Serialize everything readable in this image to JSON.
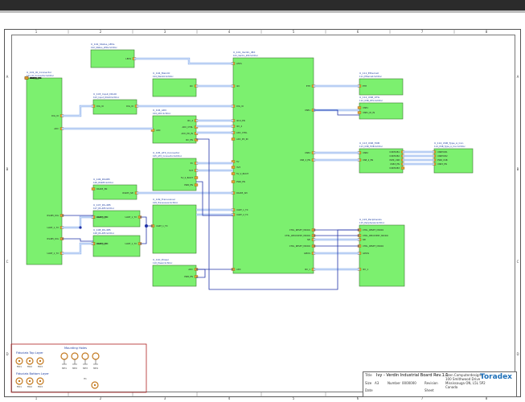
{
  "sheet": {
    "grid_cols": [
      "1",
      "2",
      "3",
      "4",
      "5",
      "6",
      "7",
      "8"
    ],
    "grid_rows": [
      "A",
      "B",
      "C",
      "D"
    ]
  },
  "blocks": [
    {
      "id": "custom",
      "title": "U_101_IO_Connector",
      "subtitle": "101_IO_Connector.SchDoc",
      "pins_left": [
        "DIG_IO",
        "ADC",
        "RS485_DIG",
        "UART_1_TX",
        "RS485_DIG",
        "UART_1_TX"
      ],
      "pins_right": []
    },
    {
      "id": "leds",
      "title": "U_102_Status_LEDs",
      "subtitle": "102_Status_LEDs.SchDoc",
      "pins_right": [
        "LEDS"
      ]
    },
    {
      "id": "main",
      "title": "U_101_Verdin_iMX",
      "subtitle": "101_Verdin_iMX.SchDoc"
    },
    {
      "id": "mux",
      "title": "U_104_MainIO",
      "subtitle": "104_MainIO.SchDoc",
      "pins_right": [
        "I2C"
      ]
    },
    {
      "id": "dig",
      "title": "U_103_Input_DIGIO",
      "subtitle": "103_Input_DIGIO.SchDoc",
      "pins_left": [
        "DIG_IO"
      ],
      "pins_right": [
        "DIG_IO"
      ]
    },
    {
      "id": "adc",
      "title": "U_104_ADC",
      "subtitle": "104_ADC.SchDoc",
      "pins_left": [
        "ADC"
      ],
      "pins_right": [
        "I2C_4",
        "ADC_CTRL",
        "ADC_PD_IN",
        "I2C_EN"
      ]
    },
    {
      "id": "atx",
      "title": "U_105_ATX_Connector",
      "subtitle": "105_ATX_Connector.SchDoc",
      "pins_right": [
        "5V",
        "3V3",
        "5V_2_BOOT",
        "PWR_EN"
      ]
    },
    {
      "id": "rs485",
      "title": "U_106_RS485",
      "subtitle": "106_RS485.SchDoc",
      "pins_left": [
        "RS485_EN"
      ],
      "pins_right": [
        "RS485_SPI"
      ]
    },
    {
      "id": "mb1",
      "title": "U_107_RS-485",
      "subtitle": "107_RS-485.SchDoc",
      "pins_left": [
        "RS485_EN",
        "UART_1_TX"
      ],
      "pins_right": [
        "UART_1_TX"
      ]
    },
    {
      "id": "mb2",
      "title": "U_108_RS-485",
      "subtitle": "108_RS-485.SchDoc",
      "pins_left": [
        "RS485_EN",
        "UART_1_TX"
      ],
      "pins_right": [
        "UART_1_TX"
      ]
    },
    {
      "id": "tr",
      "title": "U_109_Transceiver",
      "subtitle": "109_Transceiver.SchDoc",
      "pins_left": [
        "UART_1_TX"
      ]
    },
    {
      "id": "pwr",
      "title": "U_110_Power",
      "subtitle": "110_Power.SchDoc",
      "pins_right": [
        "ADC",
        "PWR_EN"
      ]
    },
    {
      "id": "eth",
      "title": "U_111_Ethernet",
      "subtitle": "111_Ethernet.SchDoc",
      "pins_left": [
        "ETH"
      ]
    },
    {
      "id": "usbotg",
      "title": "U_112_USB_OTG",
      "subtitle": "112_USB_OTG.SchDoc",
      "pins_left": [
        "USB1",
        "USB1_ID_IN"
      ]
    },
    {
      "id": "hub",
      "title": "U_113_USB_HUB",
      "subtitle": "113_USB_HUB.SchDoc",
      "pins_left": [
        "USB2",
        "USB_2_EN"
      ],
      "pins_right": [
        "USBHUB1",
        "USBHUB2",
        "PWR_USB",
        "USB3_EN",
        "USBHUB3"
      ]
    },
    {
      "id": "usbc",
      "title": "U_114_USB_Type_A_Con",
      "subtitle": "114_USB_Type_A_Con.SchDoc",
      "pins_left": [
        "USBHUB1",
        "USBHUB2",
        "PWR_USB",
        "USB3_EN"
      ]
    },
    {
      "id": "periph",
      "title": "U_115_Peripherals",
      "subtitle": "115_Peripherals.SchDoc",
      "pins_left": [
        "CTRL_RESET_MICRO",
        "CTRL_RECOVERY_MICRO",
        "SPI",
        "CTRL_RESET_MICRO",
        "GPIOS",
        "I2C_1"
      ]
    }
  ],
  "mcu_pins": {
    "left": [
      "LEDS",
      "I2C",
      "DIG_IO",
      "I2C4_EN",
      "I2C_4",
      "ADC_CTRL",
      "ADC_PD_IN",
      "5V",
      "3V3",
      "5V_2_BOOT",
      "PWR_EN",
      "RS485_SPI",
      "UART_1_TX",
      "UART_2_TX",
      "ADC"
    ],
    "right": [
      "ETH",
      "USB1",
      "USB2",
      "USB_2_EN",
      "CTRL_RESET_MICRO",
      "CTRL_RECOVERY_MICRO",
      "SPI",
      "CTRL_RESET_MICRO",
      "GPIOS",
      "I2C_1"
    ]
  },
  "legend": {
    "fiducials_top": "Fiducials Top Layer",
    "fiducials_bottom": "Fiducials Bottom Layer",
    "mounting_holes": "Mounting Holes",
    "fid_labels": [
      "FID1",
      "FID2",
      "FID3"
    ],
    "hole_labels": [
      "MH1",
      "MH2",
      "MH3",
      "MH4"
    ],
    "h_label": "H1"
  },
  "title_block": {
    "title_label": "Title",
    "title": "Ivy - Verdin Industrial Board Rev.1.1",
    "size_label": "Size",
    "size": "A3",
    "number_label": "Number",
    "number": "0000000",
    "revision_label": "Revision",
    "date_label": "Date",
    "sheet_label": "Sheet",
    "company": "Ezen Computerdesigns",
    "addr": [
      "100 Smithwood Drive",
      "Mississauga ON, L5L 5P2",
      "Canada"
    ],
    "logo": "Toradex"
  },
  "colors": {
    "block": "#7cf06f",
    "wire": "#2032a8",
    "bus": "#8fb2ee",
    "pin": "#e0a030",
    "frame": "#b02020"
  }
}
